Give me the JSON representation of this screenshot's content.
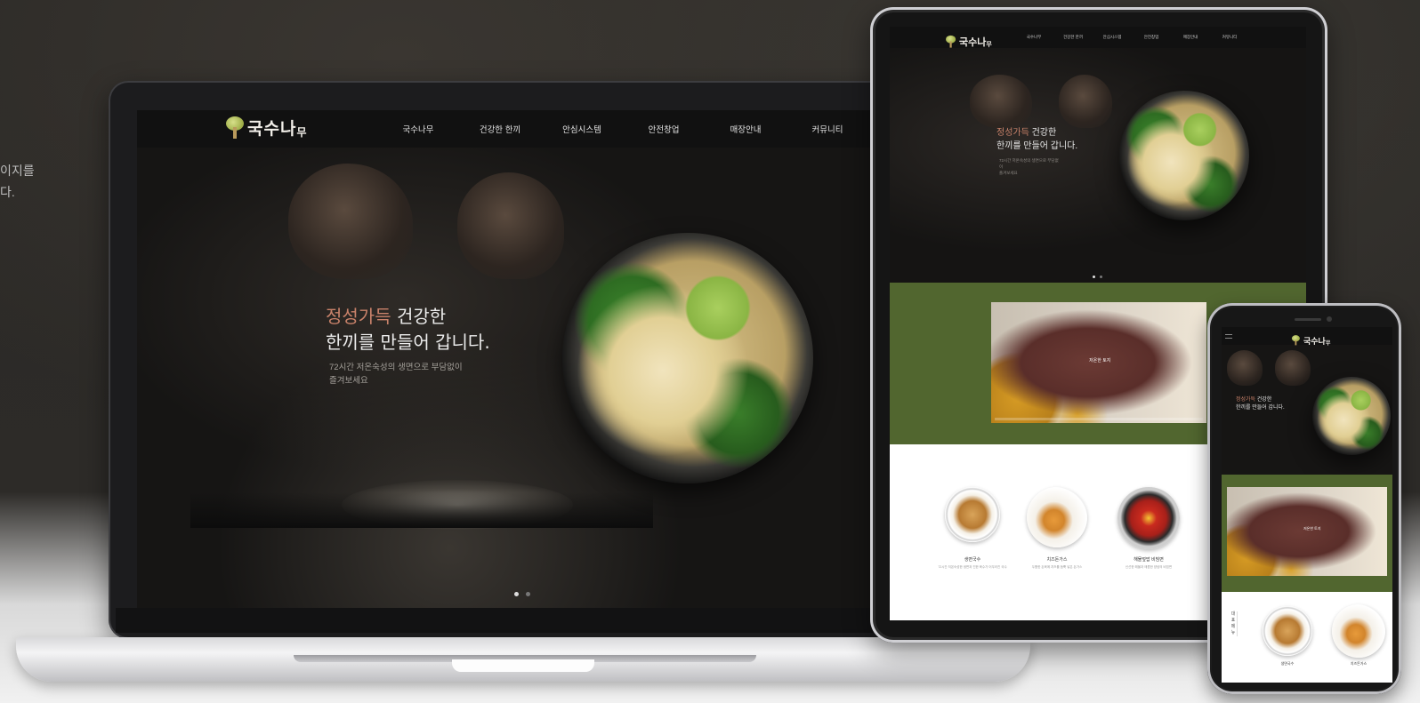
{
  "colors": {
    "accent": "#c9826a",
    "section_green": "#51662f",
    "dark_bg": "#161514"
  },
  "left_caption": {
    "line1": "이지를",
    "line2": "다."
  },
  "site": {
    "logo": {
      "main": "국수나",
      "small": "무"
    },
    "nav": [
      "국수나무",
      "건강한 한끼",
      "안심시스템",
      "안전창업",
      "매장안내",
      "커뮤니티"
    ],
    "hero": {
      "title_accent": "정성가득",
      "title_rest": " 건강한",
      "title_line2": "한끼를 만들어 갑니다.",
      "subtitle_line1": "72시간 저온숙성의 생면으로 부담없이",
      "subtitle_line2": "즐겨보세요",
      "slider_pages": 2,
      "active_page": 1
    },
    "video": {
      "label": "저온한 토지"
    },
    "menu": {
      "section_label": "대표메뉴",
      "items": [
        {
          "name": "생면국수",
          "desc": "72시간 저온숙성한 생면과 진한 육수가 어우러진 국수"
        },
        {
          "name": "치즈돈가스",
          "desc": "두툼한 돈육에 치즈를 듬뿍 넣은 돈가스"
        },
        {
          "name": "해물덮밥 비빔면",
          "desc": "신선한 해물과 매콤한 양념의 비빔면"
        }
      ]
    }
  },
  "icons": {
    "logo": "tree-icon",
    "next": "chevron-right-icon",
    "menu": "hamburger-icon"
  }
}
